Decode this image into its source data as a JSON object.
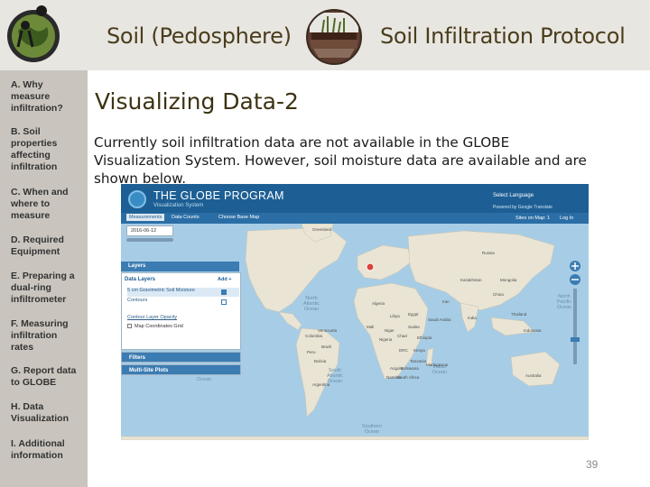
{
  "header": {
    "title_left": "Soil (Pedosphere)",
    "title_right": "Soil Infiltration Protocol"
  },
  "sidebar": {
    "items": [
      {
        "label": "A. Why\nmeasure\ninfiltration?"
      },
      {
        "label": "B. Soil\nproperties\naffecting\ninfiltration"
      },
      {
        "label": "C. When and\nwhere to\nmeasure"
      },
      {
        "label": "D. Required\nEquipment"
      },
      {
        "label": "E. Preparing a\ndual-ring\ninfiltrometer"
      },
      {
        "label": "F. Measuring\ninfiltration\nrates"
      },
      {
        "label": "G. Report data\nto GLOBE"
      },
      {
        "label": "H. Data\nVisualization"
      },
      {
        "label": "I. Additional\ninformation"
      }
    ]
  },
  "slide": {
    "title": "Visualizing Data-2",
    "body": "Currently soil infiltration data are not available in the GLOBE Visualization System. However, soil moisture data are available and are shown below.",
    "page_number": "39"
  },
  "globe_screenshot": {
    "title": "THE GLOBE PROGRAM",
    "subtitle": "Visualization System",
    "select_language": "Select Language",
    "powered_by": "Powered by Google Translate",
    "tabs": [
      "Measurements",
      "Data Counts",
      "Choose Base Map"
    ],
    "sites_on_map": "Sites on Map: 1",
    "login": "Log In",
    "date": "2016-06-12",
    "layers_header": "Layers",
    "data_layers": "Data Layers",
    "add": "Add +",
    "layer_items": [
      "5 cm Gravimetric Soil Moisture",
      "Contours"
    ],
    "contour_opacity": "Contour Layer Opacity",
    "map_grid": "Map Coordinates Grid",
    "filters": "Filters",
    "multi_site": "Multi-Site Plots",
    "ocean_labels": [
      "North Atlantic Ocean",
      "North Pacific Ocean",
      "South Atlantic Ocean",
      "Indian Ocean",
      "Pacific Ocean",
      "Southern Ocean"
    ],
    "land_labels": [
      "Greenland",
      "Libya",
      "Egypt",
      "Sudan",
      "Ethiopia",
      "Kenya",
      "Tanzania",
      "Angola",
      "Nigeria",
      "Mali",
      "Niger",
      "Chad",
      "Iran",
      "Saudi Arabia",
      "India",
      "China",
      "Mongolia",
      "Kazakhstan",
      "Russia",
      "Australia",
      "Brazil",
      "Peru",
      "Bolivia",
      "Argentina",
      "Colombia",
      "Venezuela",
      "Indonesia",
      "Thailand",
      "South Africa",
      "Madagascar",
      "Botswana",
      "Namibia",
      "DRC",
      "Algeria"
    ],
    "colors": {
      "header": "#1d5f94",
      "ocean": "#a7cde6",
      "land": "#e9e4d4",
      "marker": "#d9453a"
    }
  }
}
